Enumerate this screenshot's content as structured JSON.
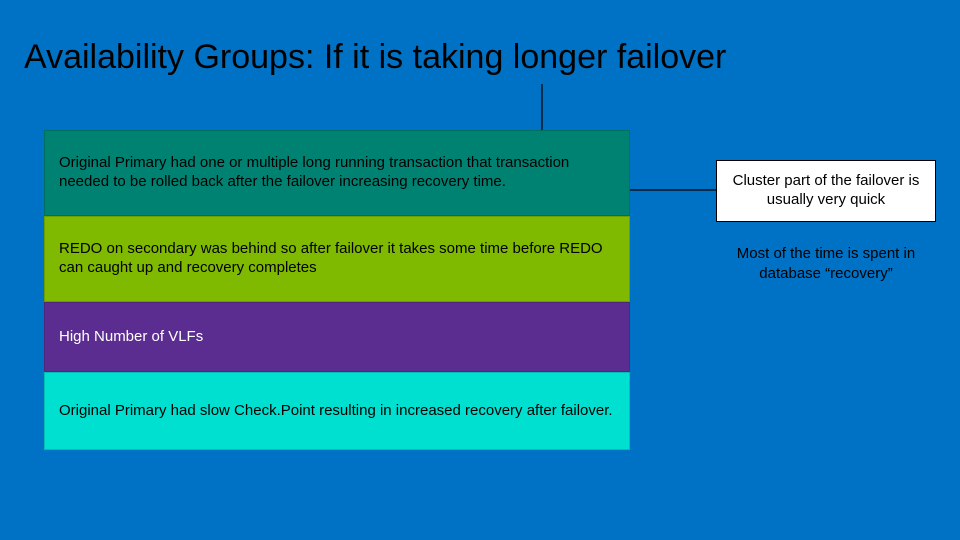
{
  "title": "Availability Groups: If it is taking longer failover",
  "left_boxes": {
    "box1": "Original Primary had one or multiple long running transaction that transaction needed to be rolled back after the failover increasing recovery time.",
    "box2": "REDO on secondary was behind so after failover it takes some time before REDO can caught up and recovery completes",
    "box3": "High Number of VLFs",
    "box4": "Original Primary had slow Check.Point resulting in increased recovery after failover."
  },
  "right": {
    "box": "Cluster part of the failover is usually very quick",
    "text": "Most of the time is spent in database “recovery”"
  }
}
